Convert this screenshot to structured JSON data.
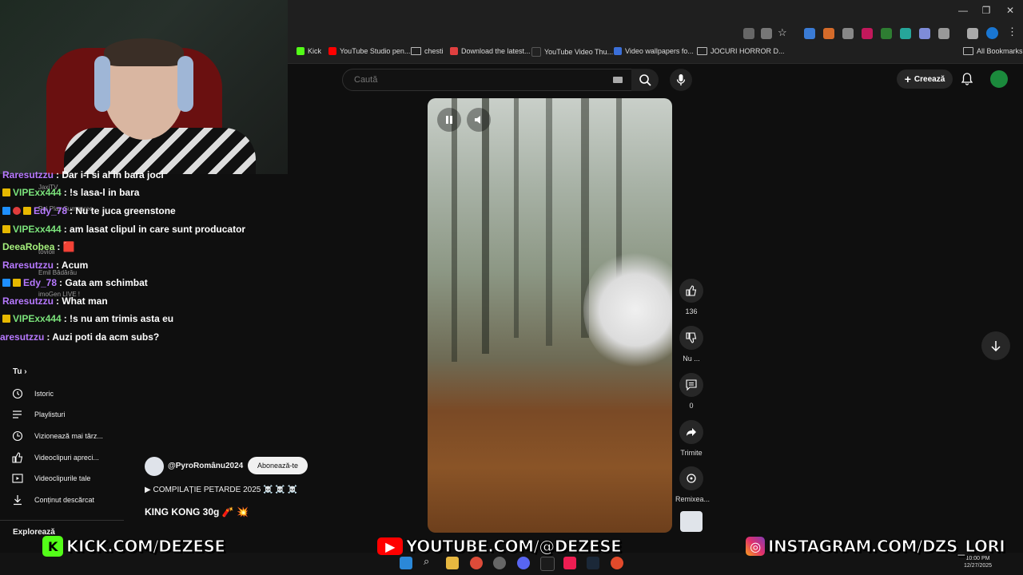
{
  "browser": {
    "bookmarks": [
      {
        "label": "Kick",
        "color": "#53fc18"
      },
      {
        "label": "YouTube Studio pen...",
        "color": "#ff0000"
      },
      {
        "label": "chesti",
        "folder": true
      },
      {
        "label": "Download the latest...",
        "color": "#e04040"
      },
      {
        "label": "YouTube Video Thu...",
        "color": "#222222"
      },
      {
        "label": "Video wallpapers fo...",
        "color": "#3b6fd8"
      },
      {
        "label": "JOCURI HORROR D...",
        "folder": true
      }
    ],
    "all_bookmarks": "All Bookmarks"
  },
  "youtube": {
    "search_placeholder": "Caută",
    "create_label": "Creează",
    "actions": {
      "like_count": "136",
      "dislike_label": "Nu ...",
      "comment_count": "0",
      "share_label": "Trimite",
      "remix_label": "Remixea..."
    },
    "channel": "@PyroRomânu2024",
    "subscribe_label": "Abonează-te",
    "playlist_line": "▶ COMPILAȚIE PETARDE 2025 ☠️ ☠️ ☠️",
    "short_title": "KING KONG 30g 🧨 💥"
  },
  "sidebar": {
    "section_you": "Tu",
    "items": [
      {
        "label": "Istoric",
        "icon": "history-icon"
      },
      {
        "label": "Playlisturi",
        "icon": "playlist-icon"
      },
      {
        "label": "Vizionează mai târz...",
        "icon": "clock-icon"
      },
      {
        "label": "Videoclipuri apreci...",
        "icon": "thumbs-up-icon"
      },
      {
        "label": "Videoclipurile tale",
        "icon": "video-icon"
      },
      {
        "label": "Conținut descărcat",
        "icon": "download-icon"
      }
    ],
    "explore": "Explorează"
  },
  "chat": [
    {
      "user": "Raresutzzu",
      "text": ": Dar i-i si al in bara joci",
      "color": "purple",
      "badges": []
    },
    {
      "user": "VIPExx444",
      "text": ": !s lasa-l in bara",
      "color": "green",
      "badges": [
        "yel"
      ]
    },
    {
      "user": "Edy_78",
      "text": ": Nu te juca greenstone",
      "color": "purple",
      "badges": [
        "blue",
        "red",
        "yel"
      ]
    },
    {
      "user": "VIPExx444",
      "text": ": am lasat clipul in care sunt producator",
      "color": "green",
      "badges": [
        "yel"
      ]
    },
    {
      "user": "DeeaRobea",
      "text": ": 🟥",
      "color": "lgreen",
      "badges": []
    },
    {
      "user": "Raresutzzu",
      "text": ": Acum",
      "color": "purple",
      "badges": []
    },
    {
      "user": "Edy_78",
      "text": ": Gata am schimbat",
      "color": "purple",
      "badges": [
        "blue",
        "yel"
      ]
    },
    {
      "user": "Raresutzzu",
      "text": ": What man",
      "color": "purple",
      "badges": []
    },
    {
      "user": "VIPExx444",
      "text": ": !s nu am trimis asta eu",
      "color": "green",
      "badges": [
        "yel"
      ]
    },
    {
      "user": "aresutzzu",
      "text": ": Auzi poti da acm subs?",
      "color": "purple",
      "badges": []
    }
  ],
  "ghost_text": [
    "JaxiTV",
    "Pui Play Sumnerec",
    "tovioii",
    "Emil Bădărău",
    "imoGen LIVE !"
  ],
  "overlay": {
    "kick": "KICK.COM/DEZESE",
    "youtube": "YOUTUBE.COM/@DEZESE",
    "instagram": "INSTAGRAM.COM/DZS_LORI"
  },
  "taskbar": {
    "time": "10:00 PM",
    "date": "12/27/2025"
  }
}
